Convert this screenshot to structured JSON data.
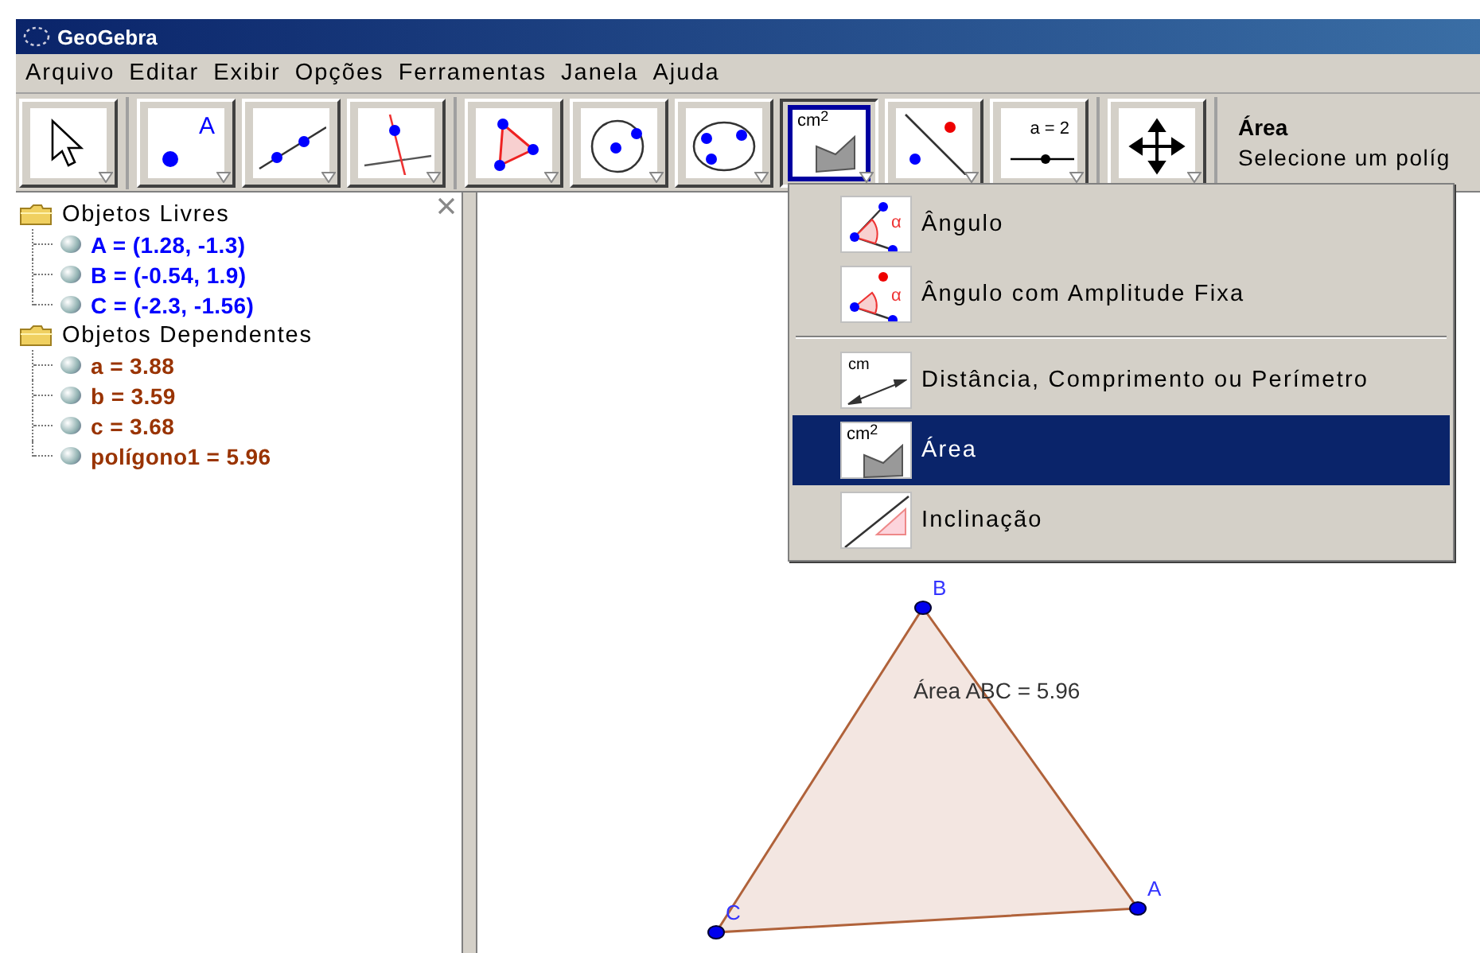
{
  "window": {
    "title": "GeoGebra"
  },
  "menubar": [
    "Arquivo",
    "Editar",
    "Exibir",
    "Opções",
    "Ferramentas",
    "Janela",
    "Ajuda"
  ],
  "toolbar": {
    "groups": [
      [
        {
          "kind": "move",
          "selected": false
        }
      ],
      [
        {
          "kind": "point",
          "selected": false,
          "icon_text": "A"
        },
        {
          "kind": "line",
          "selected": false
        },
        {
          "kind": "perpendicular",
          "selected": false
        }
      ],
      [
        {
          "kind": "polygon",
          "selected": false
        },
        {
          "kind": "circle",
          "selected": false
        },
        {
          "kind": "conic",
          "selected": false
        },
        {
          "kind": "area",
          "selected": true,
          "icon_text": "cm$^{2}$"
        },
        {
          "kind": "reflect",
          "selected": false
        },
        {
          "kind": "slider",
          "selected": false,
          "icon_text": "a = 2"
        }
      ],
      [
        {
          "kind": "translate",
          "selected": false
        }
      ]
    ],
    "tool_name": "Área",
    "tool_help": "Selecione um políg"
  },
  "algebra_view": {
    "folders": [
      {
        "label": "Objetos Livres",
        "children": [
          {
            "label": "A = (1.28, -1.3)",
            "color": "#0000ff"
          },
          {
            "label": "B = (-0.54, 1.9)",
            "color": "#0000ff"
          },
          {
            "label": "C = (-2.3, -1.56)",
            "color": "#0000ff"
          }
        ]
      },
      {
        "label": "Objetos Dependentes",
        "children": [
          {
            "label": "a = 3.88",
            "color": "#993300"
          },
          {
            "label": "b = 3.59",
            "color": "#993300"
          },
          {
            "label": "c = 3.68",
            "color": "#993300"
          },
          {
            "label": "polígono1 = 5.96",
            "color": "#993300"
          }
        ]
      }
    ]
  },
  "graphics": {
    "points": [
      "B",
      "A",
      "C"
    ],
    "area_label": "Área ABC = 5.96"
  },
  "tool_menu": {
    "groups": [
      [
        {
          "kind": "angle",
          "label": "Ângulo",
          "selected": false,
          "icon_text": "α"
        },
        {
          "kind": "fixed_angle",
          "label": "Ângulo com Amplitude Fixa",
          "selected": false,
          "icon_text": "α"
        }
      ],
      [
        {
          "kind": "distance",
          "label": "Distância, Comprimento ou Perímetro",
          "selected": false,
          "icon_text": "cm"
        },
        {
          "kind": "area",
          "label": "Área",
          "selected": true,
          "icon_text": "cm$^{2}$"
        },
        {
          "kind": "slope",
          "label": "Inclinação",
          "selected": false
        }
      ]
    ]
  }
}
